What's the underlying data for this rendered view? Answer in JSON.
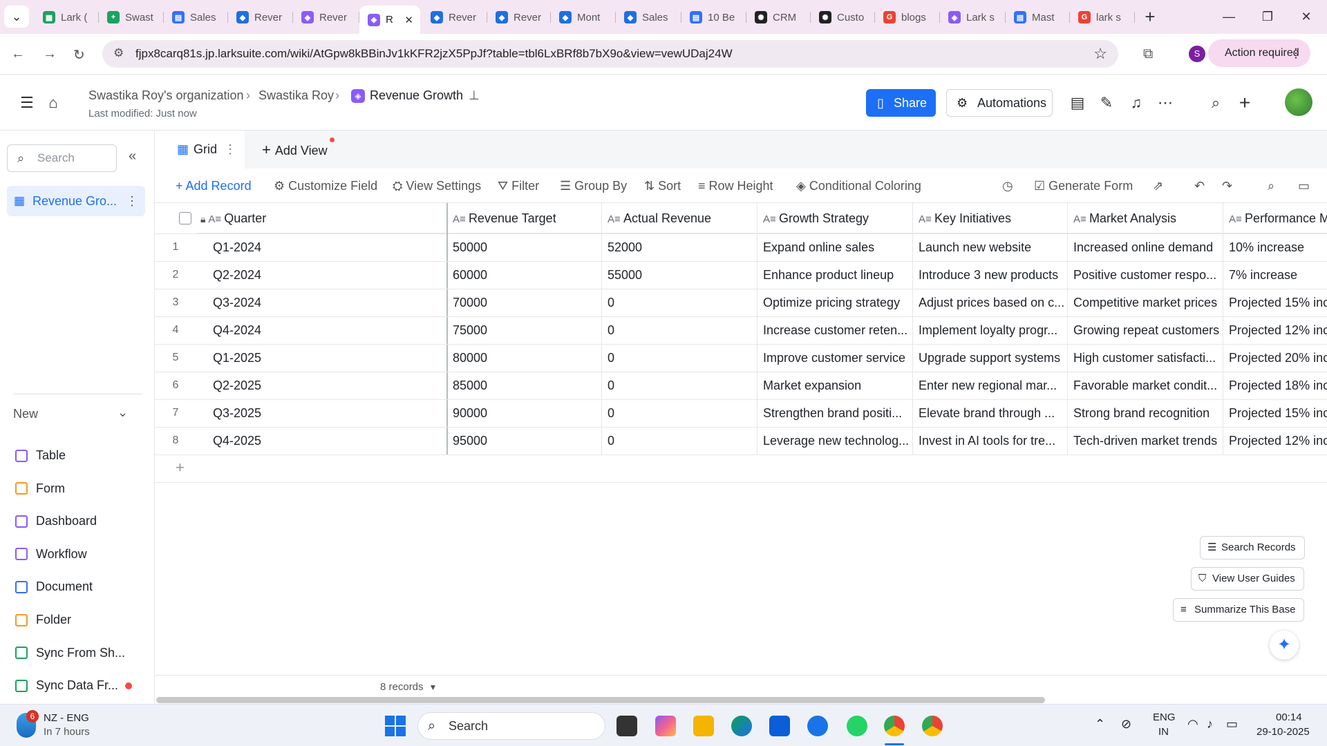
{
  "browser": {
    "tabs": [
      {
        "label": "Lark (",
        "color": "#1aa260",
        "glyph": "▦"
      },
      {
        "label": "Swast",
        "color": "#1aa260",
        "glyph": "+"
      },
      {
        "label": "Sales",
        "color": "#3370ff",
        "glyph": "▤"
      },
      {
        "label": "Rever",
        "color": "#1f6fe0",
        "glyph": "◆"
      },
      {
        "label": "Rever",
        "color": "#8a5cf6",
        "glyph": "◈"
      },
      {
        "label": "R",
        "color": "#8a5cf6",
        "glyph": "◈",
        "active": true
      },
      {
        "label": "Rever",
        "color": "#1f6fe0",
        "glyph": "◆"
      },
      {
        "label": "Rever",
        "color": "#1f6fe0",
        "glyph": "◆"
      },
      {
        "label": "Mont",
        "color": "#1f6fe0",
        "glyph": "◆"
      },
      {
        "label": "Sales",
        "color": "#1f6fe0",
        "glyph": "◆"
      },
      {
        "label": "10 Be",
        "color": "#3370ff",
        "glyph": "▤"
      },
      {
        "label": "CRM",
        "color": "#222",
        "glyph": "✺"
      },
      {
        "label": "Custo",
        "color": "#222",
        "glyph": "✺"
      },
      {
        "label": "blogs",
        "color": "#ea4335",
        "glyph": "G"
      },
      {
        "label": "Lark s",
        "color": "#8a5cf6",
        "glyph": "◈"
      },
      {
        "label": "Mast",
        "color": "#3370ff",
        "glyph": "▤"
      },
      {
        "label": "lark s",
        "color": "#ea4335",
        "glyph": "G"
      }
    ],
    "url": "fjpx8carq81s.jp.larksuite.com/wiki/AtGpw8kBBinJv1kKFR2jzX5PpJf?table=tbl6LxBRf8b7bX9o&view=vewUDaj24W",
    "profile_initial": "S",
    "action_required": "Action required"
  },
  "header": {
    "breadcrumb": [
      "Swastika Roy's organization",
      "Swastika Roy",
      "Revenue Growth"
    ],
    "last_modified": "Last modified: Just now",
    "share_label": "Share",
    "automations_label": "Automations"
  },
  "sidebar": {
    "search_placeholder": "Search",
    "active_item": "Revenue Gro...",
    "new_label": "New",
    "items": [
      "Table",
      "Form",
      "Dashboard",
      "Workflow",
      "Document",
      "Folder",
      "Sync From Sh...",
      "Sync Data Fr..."
    ]
  },
  "views": {
    "grid_label": "Grid",
    "add_view_label": "Add View"
  },
  "toolbar": {
    "add_record": "Add Record",
    "customize_field": "Customize Field",
    "view_settings": "View Settings",
    "filter": "Filter",
    "group_by": "Group By",
    "sort": "Sort",
    "row_height": "Row Height",
    "conditional_coloring": "Conditional Coloring",
    "generate_form": "Generate Form"
  },
  "table": {
    "columns": [
      "Quarter",
      "Revenue Target",
      "Actual Revenue",
      "Growth Strategy",
      "Key Initiatives",
      "Market Analysis",
      "Performance M"
    ],
    "rows": [
      [
        "Q1-2024",
        "50000",
        "52000",
        "Expand online sales",
        "Launch new website",
        "Increased online demand",
        "10% increase"
      ],
      [
        "Q2-2024",
        "60000",
        "55000",
        "Enhance product lineup",
        "Introduce 3 new products",
        "Positive customer respo...",
        "7% increase"
      ],
      [
        "Q3-2024",
        "70000",
        "0",
        "Optimize pricing strategy",
        "Adjust prices based on c...",
        "Competitive market prices",
        "Projected 15% inc"
      ],
      [
        "Q4-2024",
        "75000",
        "0",
        "Increase customer reten...",
        "Implement loyalty progr...",
        "Growing repeat customers",
        "Projected 12% inc"
      ],
      [
        "Q1-2025",
        "80000",
        "0",
        "Improve customer service",
        "Upgrade support systems",
        "High customer satisfacti...",
        "Projected 20% inc"
      ],
      [
        "Q2-2025",
        "85000",
        "0",
        "Market expansion",
        "Enter new regional mar...",
        "Favorable market condit...",
        "Projected 18% inc"
      ],
      [
        "Q3-2025",
        "90000",
        "0",
        "Strengthen brand positi...",
        "Elevate brand through ...",
        "Strong brand recognition",
        "Projected 15% inc"
      ],
      [
        "Q4-2025",
        "95000",
        "0",
        "Leverage new technolog...",
        "Invest in AI tools for tre...",
        "Tech-driven market trends",
        "Projected 12% inc"
      ]
    ],
    "records_label": "8 records"
  },
  "floating": {
    "search_records": "Search Records",
    "view_user_guides": "View User Guides",
    "summarize": "Summarize This Base"
  },
  "taskbar": {
    "weather_badge": "6",
    "weather_title": "NZ - ENG",
    "weather_sub": "In 7 hours",
    "search_label": "Search",
    "lang_top": "ENG",
    "lang_bottom": "IN",
    "time": "00:14",
    "date": "29-10-2025"
  }
}
